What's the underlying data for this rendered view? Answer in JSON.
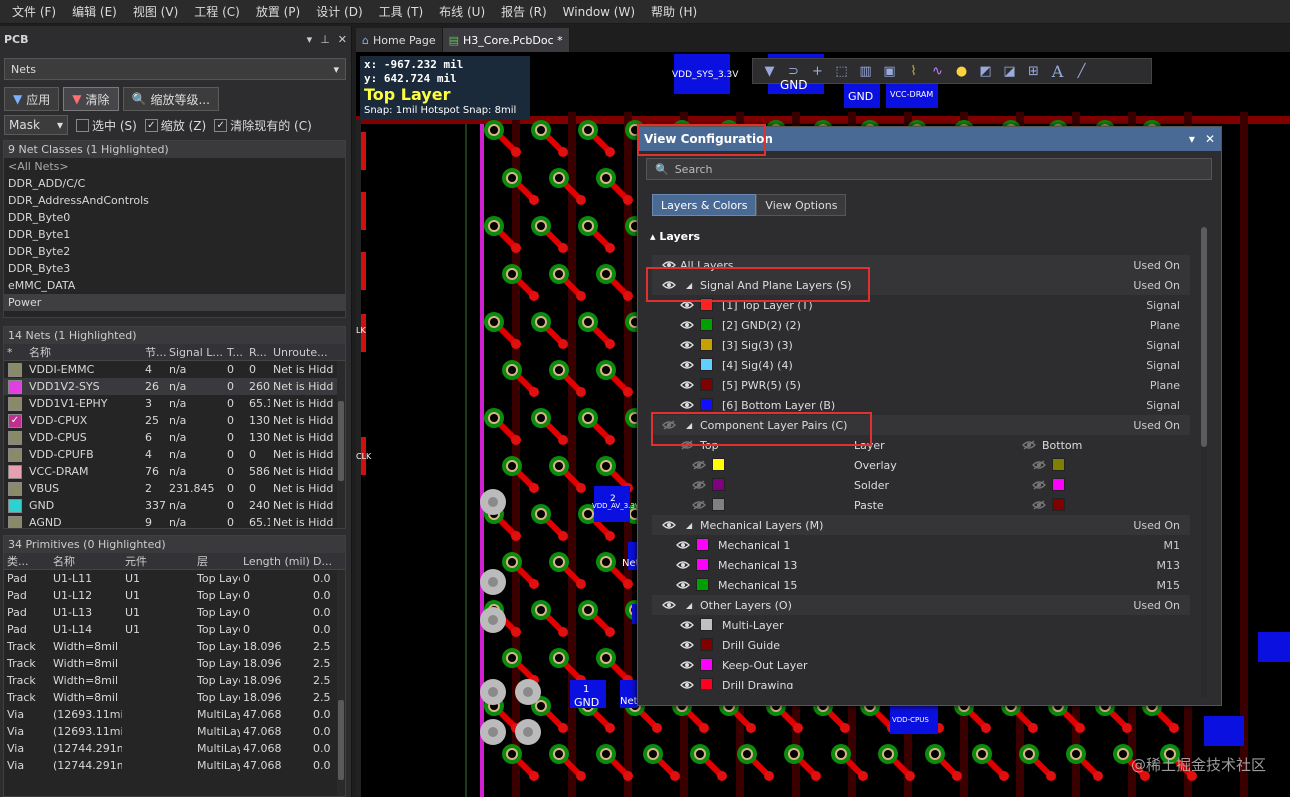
{
  "menu": [
    "文件 (F)",
    "编辑 (E)",
    "视图 (V)",
    "工程 (C)",
    "放置 (P)",
    "设计 (D)",
    "工具 (T)",
    "布线 (U)",
    "报告 (R)",
    "Window (W)",
    "帮助 (H)"
  ],
  "panel": {
    "title": "PCB",
    "mode": "Nets",
    "apply_label": "应用",
    "clear_label": "清除",
    "zoom_level_label": "缩放等级...",
    "mask": "Mask",
    "opt_select": "选中 (S)",
    "opt_zoom": "缩放 (Z)",
    "opt_clear": "清除现有的 (C)"
  },
  "net_classes": {
    "header": "9 Net Classes (1 Highlighted)",
    "items": [
      "<All Nets>",
      "DDR_ADD/C/C",
      "DDR_AddressAndControls",
      "DDR_Byte0",
      "DDR_Byte1",
      "DDR_Byte2",
      "DDR_Byte3",
      "eMMC_DATA",
      "Power"
    ],
    "highlighted": "Power"
  },
  "nets": {
    "header": "14 Nets (1 Highlighted)",
    "columns": [
      "*",
      "名称",
      "节...",
      "Signal L...",
      "T...",
      "R...",
      "Unroute..."
    ],
    "rows": [
      {
        "name": "VDDI-EMMC",
        "nodes": "4",
        "signal": "n/a",
        "t": "0",
        "r": "0",
        "unrouted": "Net is Hidd",
        "color": "#8a8a6a",
        "checked": false,
        "hl": false
      },
      {
        "name": "VDD1V2-SYS",
        "nodes": "26",
        "signal": "n/a",
        "t": "0",
        "r": "260",
        "unrouted": "Net is Hidd",
        "color": "#e040e0",
        "checked": false,
        "hl": true
      },
      {
        "name": "VDD1V1-EPHY",
        "nodes": "3",
        "signal": "n/a",
        "t": "0",
        "r": "65.1",
        "unrouted": "Net is Hidd",
        "color": "#8a8a6a",
        "checked": false,
        "hl": false
      },
      {
        "name": "VDD-CPUX",
        "nodes": "25",
        "signal": "n/a",
        "t": "0",
        "r": "130",
        "unrouted": "Net is Hidd",
        "color": "#c03090",
        "checked": true,
        "hl": false
      },
      {
        "name": "VDD-CPUS",
        "nodes": "6",
        "signal": "n/a",
        "t": "0",
        "r": "130",
        "unrouted": "Net is Hidd",
        "color": "#8a8a6a",
        "checked": false,
        "hl": false
      },
      {
        "name": "VDD-CPUFB",
        "nodes": "4",
        "signal": "n/a",
        "t": "0",
        "r": "0",
        "unrouted": "Net is Hidd",
        "color": "#8a8a6a",
        "checked": false,
        "hl": false
      },
      {
        "name": "VCC-DRAM",
        "nodes": "76",
        "signal": "n/a",
        "t": "0",
        "r": "586",
        "unrouted": "Net is Hidd",
        "color": "#e8a0b0",
        "checked": false,
        "hl": false
      },
      {
        "name": "VBUS",
        "nodes": "2",
        "signal": "231.845",
        "t": "0",
        "r": "0",
        "unrouted": "Net is Hidd",
        "color": "#8a8a6a",
        "checked": false,
        "hl": false
      },
      {
        "name": "GND",
        "nodes": "337",
        "signal": "n/a",
        "t": "0",
        "r": "240",
        "unrouted": "Net is Hidd",
        "color": "#30d0d0",
        "checked": false,
        "hl": false
      },
      {
        "name": "AGND",
        "nodes": "9",
        "signal": "n/a",
        "t": "0",
        "r": "65.1",
        "unrouted": "Net is Hidd",
        "color": "#8a8a6a",
        "checked": false,
        "hl": false
      }
    ]
  },
  "primitives": {
    "header": "34 Primitives (0 Highlighted)",
    "columns": [
      "类...",
      "名称",
      "元件",
      "层",
      "Length (mil)",
      "D..."
    ],
    "rows": [
      [
        "Pad",
        "U1-L11",
        "U1",
        "Top Layer",
        "0",
        "0.0"
      ],
      [
        "Pad",
        "U1-L12",
        "U1",
        "Top Layer",
        "0",
        "0.0"
      ],
      [
        "Pad",
        "U1-L13",
        "U1",
        "Top Layer",
        "0",
        "0.0"
      ],
      [
        "Pad",
        "U1-L14",
        "U1",
        "Top Layer",
        "0",
        "0.0"
      ],
      [
        "Track",
        "Width=8mil (",
        "",
        "Top Layer",
        "18.096",
        "2.5"
      ],
      [
        "Track",
        "Width=8mil (",
        "",
        "Top Layer",
        "18.096",
        "2.5"
      ],
      [
        "Track",
        "Width=8mil (",
        "",
        "Top Layer",
        "18.096",
        "2.5"
      ],
      [
        "Track",
        "Width=8mil (",
        "",
        "Top Layer",
        "18.096",
        "2.5"
      ],
      [
        "Via",
        "(12693.11mil,8",
        "",
        "MultiLayer",
        "47.068",
        "0.0"
      ],
      [
        "Via",
        "(12693.11mil,8",
        "",
        "MultiLayer",
        "47.068",
        "0.0"
      ],
      [
        "Via",
        "(12744.291mil",
        "",
        "MultiLayer",
        "47.068",
        "0.0"
      ],
      [
        "Via",
        "(12744.291mil",
        "",
        "MultiLayer",
        "47.068",
        "0.0"
      ]
    ]
  },
  "tabs": [
    {
      "label": "Home Page",
      "active": false
    },
    {
      "label": "H3_Core.PcbDoc *",
      "active": true
    }
  ],
  "canvas": {
    "x_label": "x:",
    "x_value": "-967.232 mil",
    "y_label": "y:",
    "y_value": "642.724 mil",
    "layer": "Top Layer",
    "snap": "Snap: 1mil Hotspot Snap: 8mil",
    "labels": {
      "vdd_sys": "VDD_SYS_3.3V",
      "gnd1": "GND",
      "gnd2": "GND",
      "vcc_dram": "VCC-DRAM",
      "gnd3": "GND",
      "vdd_av": "VDD_AV_3.3V",
      "vdd_cpus": "VDD-CPUS",
      "net1": "Net",
      "net2": "Net",
      "clk": "CLK",
      "lk": "LK",
      "pad_num1": "1",
      "pad_num2": "2"
    }
  },
  "view_config": {
    "title": "View Configuration",
    "search_placeholder": "Search",
    "tab_layers": "Layers & Colors",
    "tab_options": "View Options",
    "layers_header": "Layers",
    "all_layers": "All Layers",
    "used_on": "Used On",
    "signal_group": "Signal And Plane Layers (S)",
    "signal_layers": [
      {
        "name": "[1] Top Layer (T)",
        "color": "#ff2020",
        "type": "Signal"
      },
      {
        "name": "[2] GND(2) (2)",
        "color": "#00a000",
        "type": "Plane"
      },
      {
        "name": "[3] Sig(3) (3)",
        "color": "#c8a000",
        "type": "Signal"
      },
      {
        "name": "[4] Sig(4) (4)",
        "color": "#60d0ff",
        "type": "Signal"
      },
      {
        "name": "[5] PWR(5) (5)",
        "color": "#800000",
        "type": "Plane"
      },
      {
        "name": "[6] Bottom Layer (B)",
        "color": "#1010ff",
        "type": "Signal"
      }
    ],
    "component_group": "Component Layer Pairs (C)",
    "comp_header": {
      "top": "Top",
      "layer": "Layer",
      "bottom": "Bottom"
    },
    "comp_pairs": [
      {
        "layer": "Overlay",
        "top_color": "#ffff00",
        "bottom_color": "#808000"
      },
      {
        "layer": "Solder",
        "top_color": "#800080",
        "bottom_color": "#ff00ff"
      },
      {
        "layer": "Paste",
        "top_color": "#808080",
        "bottom_color": "#800000"
      }
    ],
    "mech_group": "Mechanical Layers (M)",
    "mech_layers": [
      {
        "name": "Mechanical 1",
        "color": "#ff00ff",
        "used": "M1"
      },
      {
        "name": "Mechanical 13",
        "color": "#ff00ff",
        "used": "M13"
      },
      {
        "name": "Mechanical 15",
        "color": "#00a000",
        "used": "M15"
      }
    ],
    "other_group": "Other Layers (O)",
    "other_layers": [
      {
        "name": "Multi-Layer",
        "color": "#c0c0c0"
      },
      {
        "name": "Drill Guide",
        "color": "#800000"
      },
      {
        "name": "Keep-Out Layer",
        "color": "#ff00ff"
      },
      {
        "name": "Drill Drawing",
        "color": "#ff0020"
      }
    ]
  },
  "watermark": "@稀土掘金技术社区"
}
